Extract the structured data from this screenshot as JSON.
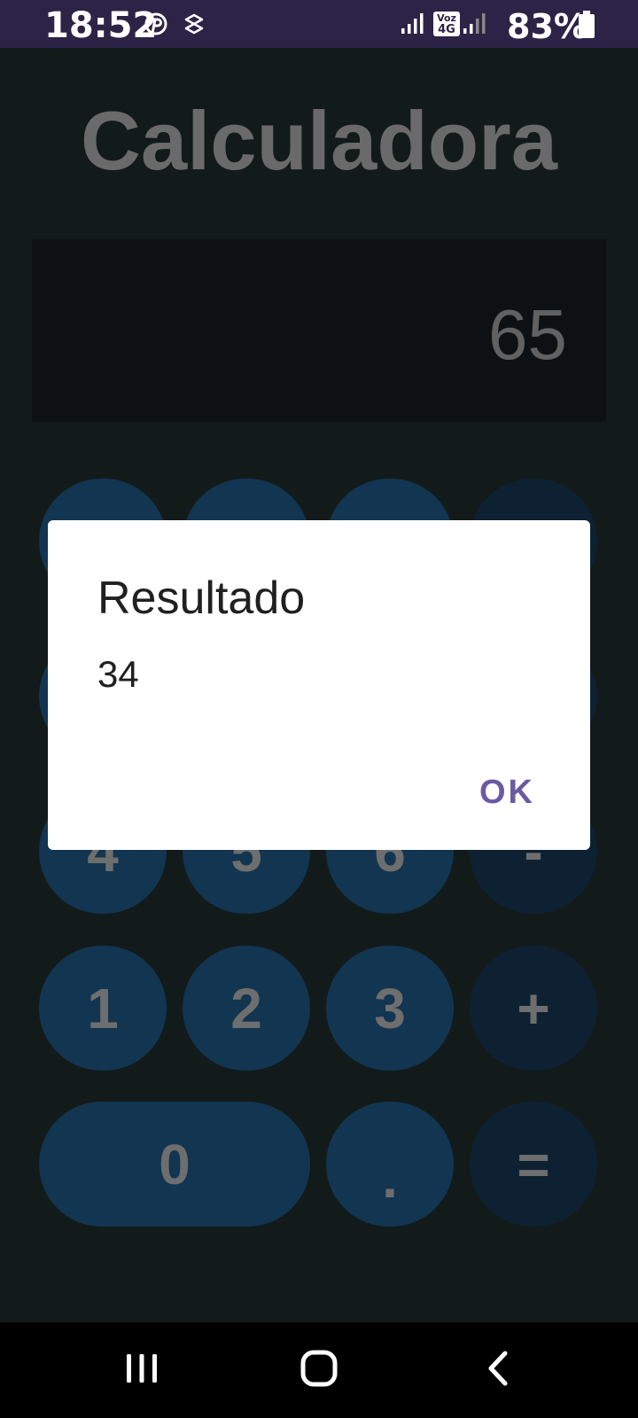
{
  "status_bar": {
    "time": "18:52",
    "battery": "83%",
    "icons": [
      "pinterest-icon",
      "vpn-icon",
      "signal-icon",
      "volte-icon",
      "signal-icon",
      "battery-icon"
    ],
    "volte_label_top": "Voz",
    "volte_label_bottom": "4G"
  },
  "app": {
    "title": "Calculadora",
    "display_value": "65"
  },
  "keypad": {
    "row3": [
      "4",
      "5",
      "6",
      "-"
    ],
    "row4": [
      "1",
      "2",
      "3",
      "+"
    ],
    "row5": [
      "0",
      ".",
      "="
    ]
  },
  "dialog": {
    "title": "Resultado",
    "message": "34",
    "ok_label": "OK"
  },
  "nav_bar": {
    "icons": [
      "recent-apps-icon",
      "home-icon",
      "back-icon"
    ]
  },
  "colors": {
    "status_bar": "#2c2346",
    "background": "#131a1a",
    "key_number": "#123551",
    "key_operator": "#0d2133",
    "dialog_accent": "#6a5aa3"
  }
}
